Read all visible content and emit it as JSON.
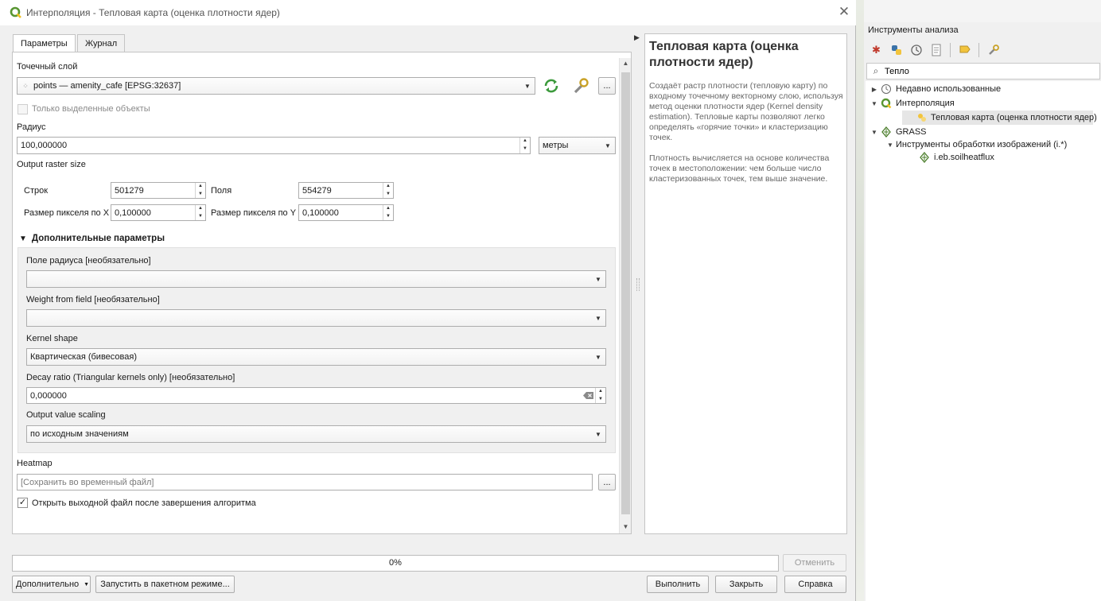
{
  "dialog": {
    "title": "Интерполяция - Тепловая карта (оценка плотности ядер)",
    "tabs": [
      "Параметры",
      "Журнал"
    ]
  },
  "params": {
    "point_layer_label": "Точечный слой",
    "point_layer_value": "points — amenity_cafe [EPSG:32637]",
    "selected_only_label": "Только выделенные объекты",
    "radius_label": "Радиус",
    "radius_value": "100,000000",
    "radius_unit": "метры",
    "raster_size_label": "Output raster size",
    "rows_label": "Строк",
    "rows_value": "501279",
    "cols_label": "Поля",
    "cols_value": "554279",
    "pixel_x_label": "Размер пикселя по X",
    "pixel_x_value": "0,100000",
    "pixel_y_label": "Размер пикселя по Y",
    "pixel_y_value": "0,100000",
    "ellipsis": "...",
    "advanced_label": "Дополнительные параметры",
    "radius_field_label": "Поле радиуса [необязательно]",
    "radius_field_value": "",
    "weight_field_label": "Weight from field [необязательно]",
    "weight_field_value": "",
    "kernel_shape_label": "Kernel shape",
    "kernel_shape_value": "Квартическая (бивесовая)",
    "decay_label": "Decay ratio (Triangular kernels only) [необязательно]",
    "decay_value": "0,000000",
    "scaling_label": "Output value scaling",
    "scaling_value": "по исходным значениям",
    "heatmap_label": "Heatmap",
    "heatmap_placeholder": "[Сохранить во временный файл]",
    "open_output_label": "Открыть выходной файл после завершения алгоритма",
    "open_output_checked": true
  },
  "help": {
    "title": "Тепловая карта (оценка плотности ядер)",
    "p1": "Создаёт растр плотности (тепловую карту) по входному точечному векторному слою, используя метод оценки плотности ядер (Kernel density estimation). Тепловые карты позволяют легко определять «горячие точки» и кластеризацию точек.",
    "p2": "Плотность вычисляется на основе количества точек в местоположении: чем больше число кластеризованных точек, тем выше значение."
  },
  "progress": {
    "value": 0,
    "text": "0%"
  },
  "buttons": {
    "cancel": "Отменить",
    "advanced": "Дополнительно",
    "batch": "Запустить в пакетном режиме...",
    "run": "Выполнить",
    "close": "Закрыть",
    "help": "Справка"
  },
  "toolbox": {
    "title": "Инструменты анализа",
    "search_value": "Тепло",
    "tree": [
      {
        "label": "Недавно использованные",
        "level": 0,
        "expanded": false
      },
      {
        "label": "Интерполяция",
        "level": 0,
        "expanded": true
      },
      {
        "label": "Тепловая карта (оценка плотности ядер)",
        "level": 1,
        "selected": true
      },
      {
        "label": "GRASS",
        "level": 0,
        "expanded": true
      },
      {
        "label": "Инструменты обработки изображений (i.*)",
        "level": 1,
        "expanded": true
      },
      {
        "label": "i.eb.soilheatflux",
        "level": 2
      }
    ]
  },
  "colors": {
    "qgis_green": "#589632",
    "qgis_yellow": "#f0c020",
    "progress_fill": "#3c8dde"
  }
}
